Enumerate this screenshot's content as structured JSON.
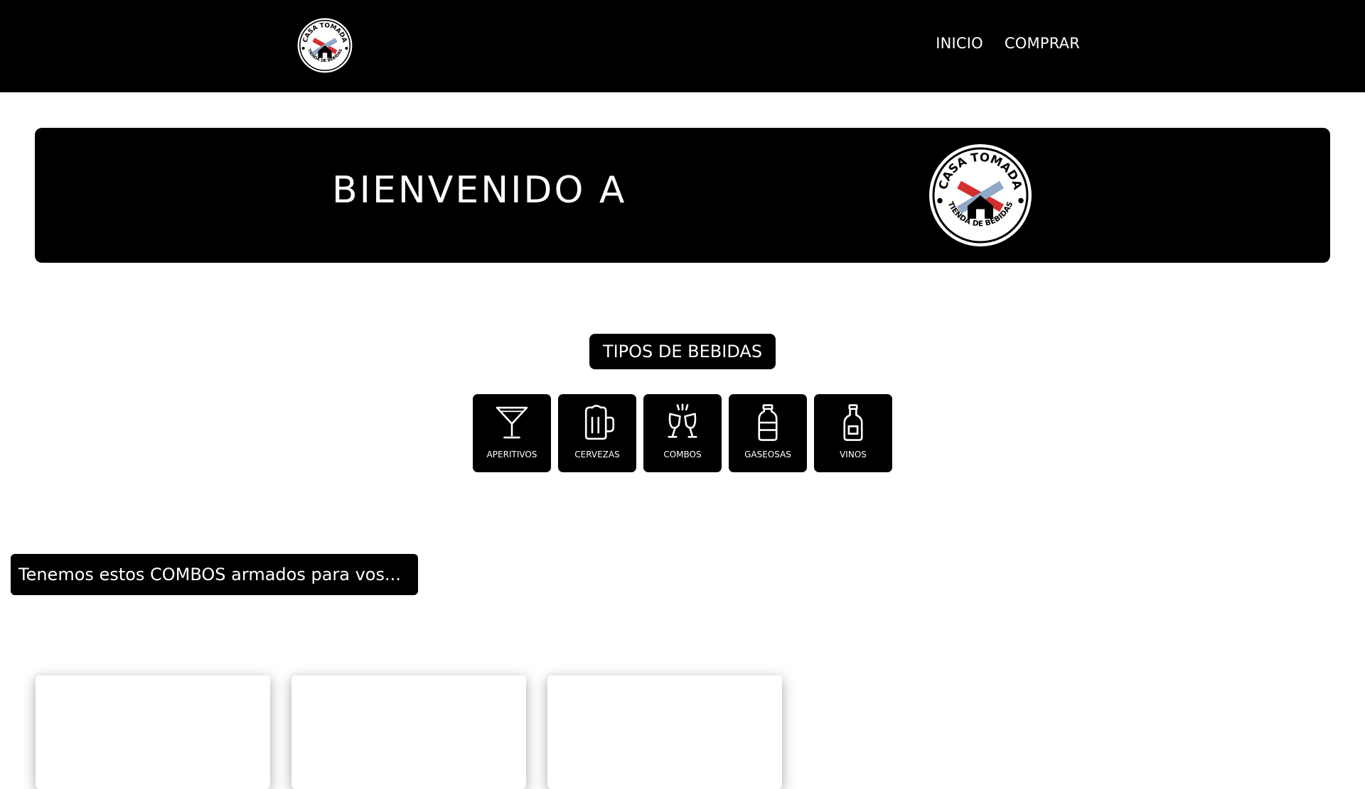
{
  "nav": {
    "logo_icon": "casa-tomada-logo-icon",
    "logo_text_top": "CASA TOMADA",
    "logo_text_bottom": "TIENDA DE BEBIDAS",
    "links": [
      "INICIO",
      "COMPRAR"
    ]
  },
  "hero": {
    "title": "BIENVENIDO A",
    "logo_text_top": "CASA TOMADA",
    "logo_text_bottom": "TIENDA DE BEBIDAS"
  },
  "categories": {
    "title": "TIPOS DE BEBIDAS",
    "items": [
      {
        "label": "APERITIVOS",
        "icon": "cocktail-glass-icon"
      },
      {
        "label": "CERVEZAS",
        "icon": "beer-mug-icon"
      },
      {
        "label": "COMBOS",
        "icon": "toast-glasses-icon"
      },
      {
        "label": "GASEOSAS",
        "icon": "soda-bottle-icon"
      },
      {
        "label": "VINOS",
        "icon": "wine-bottle-icon"
      }
    ]
  },
  "combos": {
    "title": "Tenemos estos COMBOS armados para vos..."
  },
  "colors": {
    "background": "#ffffff",
    "dark": "#000000",
    "accent_red": "#d32f2f",
    "accent_blue": "#8fa8c8"
  }
}
